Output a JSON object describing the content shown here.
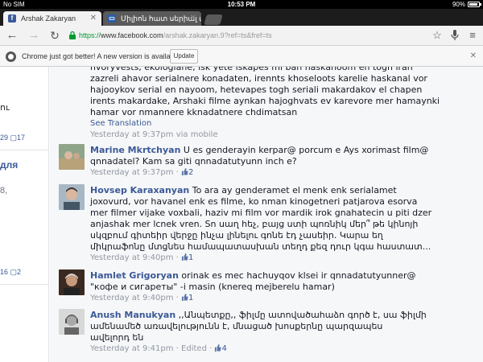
{
  "status_bar": {
    "carrier": "No SIM",
    "time": "10:53 PM",
    "battery": "90%"
  },
  "tabs": [
    {
      "title": "Arshak Zakaryan",
      "favicon": "facebook-icon",
      "active": true
    },
    {
      "title": "Միլիոն հատ սերիալ ա",
      "favicon": "page-icon",
      "active": false
    }
  ],
  "toolbar": {
    "url_scheme": "https://",
    "url_host": "www.facebook.com",
    "url_path": "/arshak.zakaryan.9?ref=ts&fref=ts"
  },
  "infobar": {
    "message": "Chrome just got better! A new version is available.",
    "button_label": "Update"
  },
  "left_column": {
    "fragment_1": "ու",
    "stat_1a": "29",
    "stat_1b": "17",
    "fragment_2": "для",
    "fragment_3": "8,",
    "stat_2a": "16",
    "stat_2b": "2"
  },
  "comments": [
    {
      "author": "",
      "lines": [
        "hvoryvests, ekologiane, isk yete iskapes mi ban haskanoom en togh iran",
        "zazreli ahavor serialnere konadaten, irennts khoseloots karelie haskanal vor",
        "hajooykov serial en nayoom, hetevapes togh seriali makardakov el chapen",
        "irents makardake, Arshaki filme aynkan hajoghvats ev karevore mer hamaynki",
        "hamar vor nmannere kknadatnere chdimatsan"
      ],
      "see_translation": "See Translation",
      "time": "Yesterday at 9:37pm",
      "extra": "via mobile",
      "likes": ""
    },
    {
      "author": "Marine Mkrtchyan",
      "lines": [
        "U es genderayin kerpar@ porcum e Ays xorimast film@",
        "qnnadatel? Kam sa giti qnnadatutyunn inch e?"
      ],
      "time": "Yesterday at 9:37pm",
      "likes": "2"
    },
    {
      "author": "Hovsep Karaxanyan",
      "lines": [
        "To ara ay genderamet el menk enk serialamet",
        "joxovurd, vor havanel enk es filme, ko nman kinogetneri patjarova esorva",
        "mer filmer vijake voxbali, haziv mi film vor mardik irok gnahatecin u piti dzer",
        "anjashak mer lcnek vren. Sn սաղ հեչ, բայց ստի պոռնիկ մեր՞ թե կինոյի",
        "սկզբում գիտեիր վերջը ինչա լինելու գոնե էդ չասեիր. Կարա եղ",
        "միկրաֆոնը մտցնես համապատասխան տեղդ քեզ դուր կգա հաստատ..."
      ],
      "time": "Yesterday at 9:40pm",
      "likes": "1"
    },
    {
      "author": "Hamlet Grigoryan",
      "lines": [
        "orinak es mec hachuyqov klsei ir qnnadatutyunner@",
        "\"кофе и сигареты\" -i masin (knereq mejberelu hamar)"
      ],
      "time": "Yesterday at 9:40pm",
      "likes": "1"
    },
    {
      "author": "Anush Manukyan",
      "lines": [
        ",,Անպետքը,, ֆիլմը ատովածահաձո գործ է, սա ֆիլմի",
        "ամենամեծ առավելությունն է, մնացած խոսքերնը պարզապես",
        "ավելորդ են"
      ],
      "time": "Yesterday at 9:41pm",
      "extra": "Edited",
      "likes": "4"
    }
  ]
}
